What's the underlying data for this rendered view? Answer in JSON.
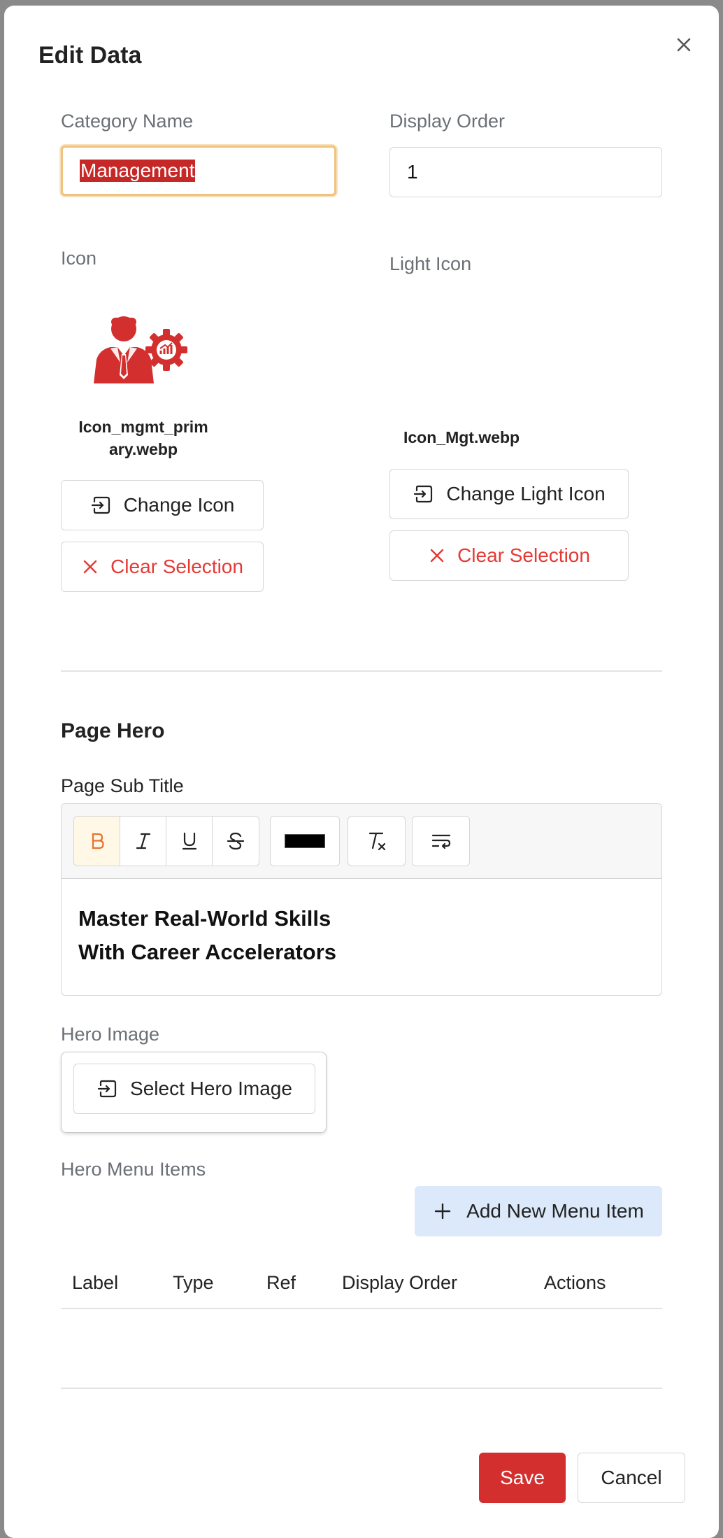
{
  "dialog": {
    "title": "Edit Data",
    "close_icon": "close-icon"
  },
  "fields": {
    "category_name_label": "Category Name",
    "category_name_value": "Management",
    "display_order_label": "Display Order",
    "display_order_value": "1"
  },
  "icon": {
    "label": "Icon",
    "file_name_line1": "Icon_mgmt_prim",
    "file_name_line2": "ary.webp",
    "change_label": "Change Icon",
    "clear_label": "Clear Selection"
  },
  "light_icon": {
    "label": "Light Icon",
    "file_name": "Icon_Mgt.webp",
    "change_label": "Change Light Icon",
    "clear_label": "Clear Selection"
  },
  "page_hero": {
    "section_title": "Page Hero",
    "sub_title_label": "Page Sub Title",
    "editor_line1": "Master Real-World Skills",
    "editor_line2": "With Career Accelerators",
    "toolbar": [
      "bold",
      "italic",
      "underline",
      "strikethrough",
      "text-color",
      "clear-format",
      "wrap"
    ],
    "text_color": "#000000",
    "hero_image_label": "Hero Image",
    "select_hero_image_label": "Select Hero Image",
    "hero_menu_items_label": "Hero Menu Items",
    "add_menu_item_label": "Add New Menu Item"
  },
  "menu_table": {
    "columns": [
      "Label",
      "Type",
      "Ref",
      "Display Order",
      "Actions"
    ],
    "rows": []
  },
  "footer": {
    "save_label": "Save",
    "cancel_label": "Cancel"
  },
  "colors": {
    "accent_red": "#d32f2f",
    "focus_ring": "#f0c27f",
    "add_button_bg": "#dbe9fb"
  }
}
